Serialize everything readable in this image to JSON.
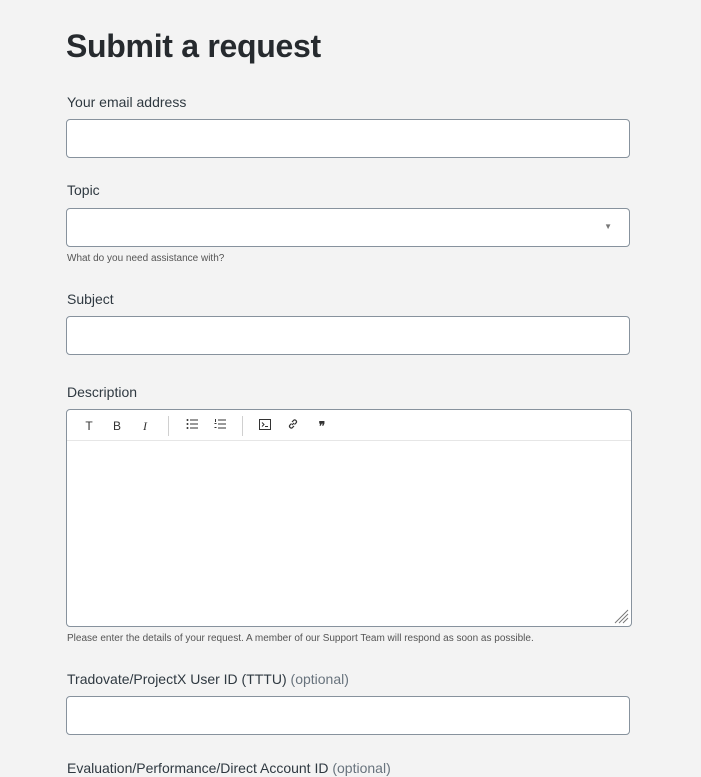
{
  "page": {
    "title": "Submit a request"
  },
  "form": {
    "email": {
      "label": "Your email address",
      "value": ""
    },
    "topic": {
      "label": "Topic",
      "value": "",
      "hint": "What do you need assistance with?"
    },
    "subject": {
      "label": "Subject",
      "value": ""
    },
    "description": {
      "label": "Description",
      "value": "",
      "hint": "Please enter the details of your request. A member of our Support Team will respond as soon as possible.",
      "toolbar": {
        "text_label": "T",
        "bold_label": "B",
        "italic_label": "I"
      }
    },
    "user_id": {
      "label": "Tradovate/ProjectX User ID (TTTU)",
      "optional": "(optional)",
      "value": ""
    },
    "account_id": {
      "label": "Evaluation/Performance/Direct Account ID",
      "optional": "(optional)"
    }
  },
  "icons": [
    "caret-down-icon",
    "bullet-list-icon",
    "numbered-list-icon",
    "code-block-icon",
    "link-icon",
    "quote-icon",
    "resize-grip-icon"
  ]
}
